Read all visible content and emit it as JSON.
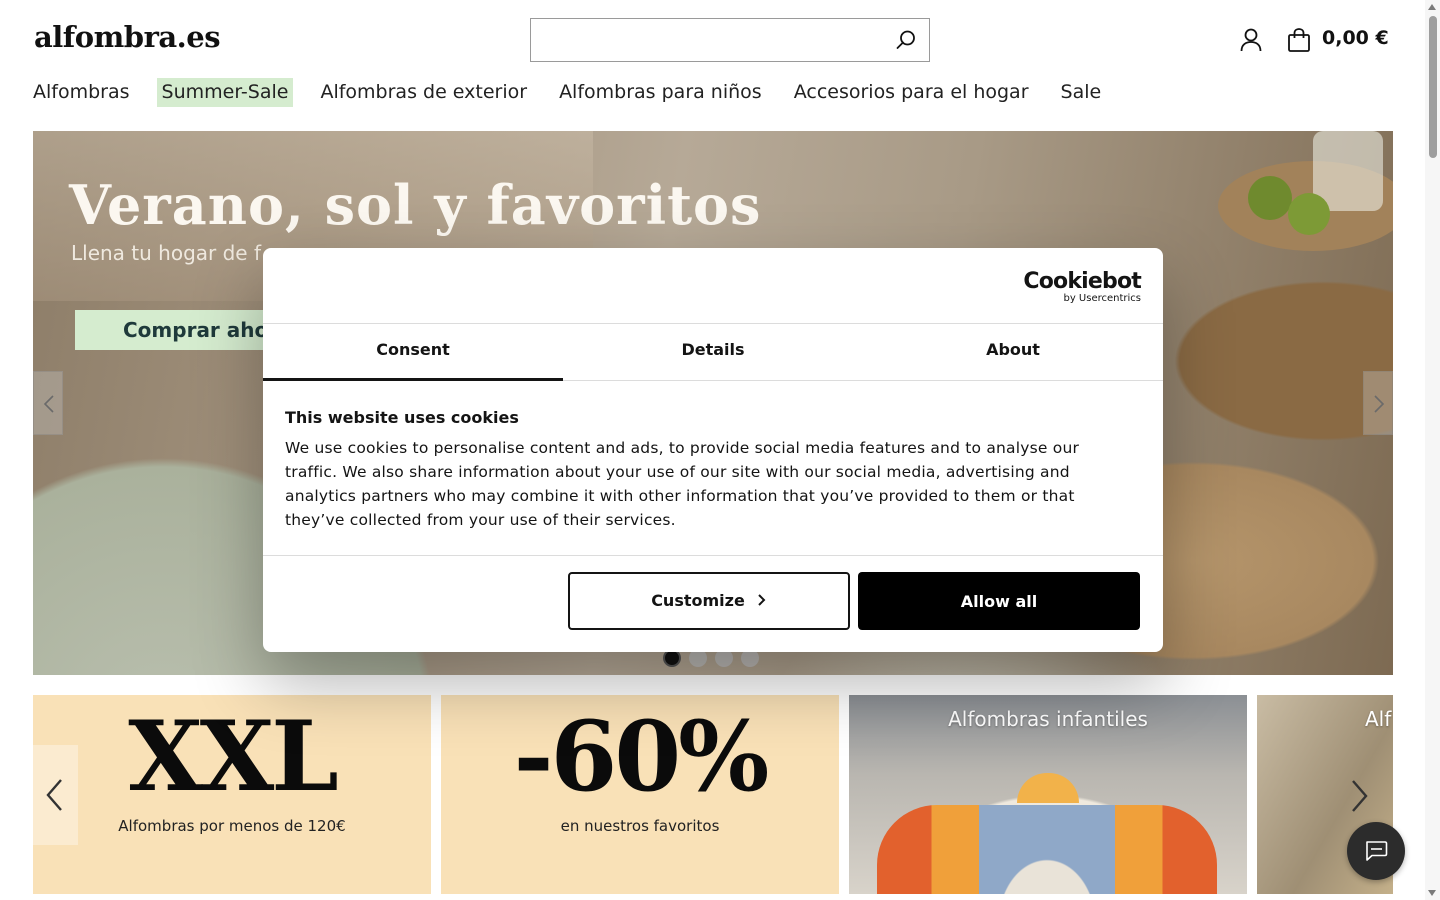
{
  "header": {
    "logo": "alfombra.es",
    "search": {
      "value": "",
      "placeholder": ""
    },
    "cart_total": "0,00 €"
  },
  "nav": {
    "items": [
      {
        "label": "Alfombras"
      },
      {
        "label": "Summer-Sale",
        "highlighted": true
      },
      {
        "label": "Alfombras de exterior"
      },
      {
        "label": "Alfombras para niños"
      },
      {
        "label": "Accesorios para el hogar"
      },
      {
        "label": "Sale"
      }
    ]
  },
  "hero": {
    "title": "Verano, sol y favoritos",
    "subtitle": "Llena tu hogar de f",
    "cta": "Comprar aho",
    "slides_total": 4,
    "active_slide": 1
  },
  "tiles": [
    {
      "big": "XXL",
      "small": "Alfombras por menos de 120€"
    },
    {
      "big": "-60%",
      "small": "en nuestros favoritos"
    },
    {
      "label": "Alfombras infantiles"
    },
    {
      "label": "Alf"
    }
  ],
  "cookie_dialog": {
    "brand": "Cookiebot",
    "brand_sub": "by Usercentrics",
    "tabs": [
      "Consent",
      "Details",
      "About"
    ],
    "active_tab": "Consent",
    "heading": "This website uses cookies",
    "body": "We use cookies to personalise content and ads, to provide social media features and to analyse our traffic. We also share information about your use of our site with our social media, advertising and analytics partners who may combine it with other information that you’ve provided to them or that they’ve collected from your use of their services.",
    "customize_label": "Customize",
    "allow_all_label": "Allow all"
  },
  "colors": {
    "accent_green": "#d5eccf",
    "tile_peach": "#f9e1b7",
    "dialog_primary": "#000000"
  },
  "icons": {
    "search": "search-icon",
    "user": "user-icon",
    "cart": "shopping-bag-icon",
    "chat": "chat-icon"
  }
}
